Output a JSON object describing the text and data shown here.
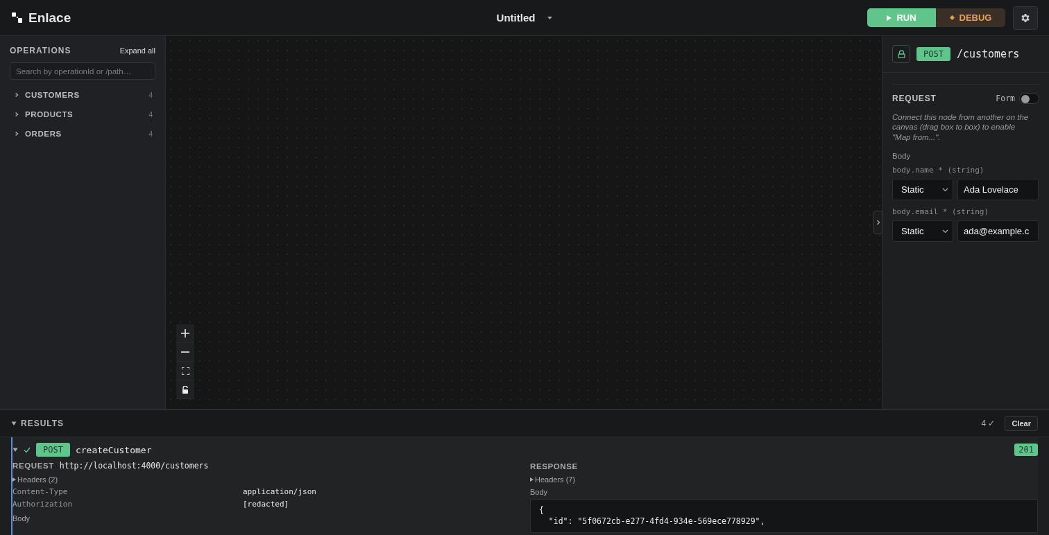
{
  "app": {
    "name": "Enlace"
  },
  "document": {
    "title": "Untitled"
  },
  "toolbar": {
    "run": "RUN",
    "debug": "DEBUG"
  },
  "sidebar": {
    "title": "OPERATIONS",
    "expand_all": "Expand all",
    "search": {
      "placeholder": "Search by operationId or /path…"
    },
    "groups": [
      {
        "label": "CUSTOMERS",
        "count": "4",
        "expanded": false
      },
      {
        "label": "PRODUCTS",
        "count": "4",
        "expanded": false
      },
      {
        "label": "ORDERS",
        "count": "4",
        "expanded": false
      }
    ]
  },
  "inspector": {
    "method": "POST",
    "path": "/customers",
    "section": "REQUEST",
    "form_toggle": {
      "label": "Form",
      "on": false
    },
    "hint": "Connect this node from another on the canvas (drag box to box) to enable \"Map from...\".",
    "body_label": "Body",
    "fields": [
      {
        "label": "body.name * (string)",
        "source": "Static",
        "value": "Ada Lovelace"
      },
      {
        "label": "body.email * (string)",
        "source": "Static",
        "value": "ada@example.c"
      }
    ]
  },
  "results": {
    "title": "RESULTS",
    "expanded": true,
    "count": "4 ✓",
    "clear": "Clear",
    "entries": [
      {
        "expanded": true,
        "ok": true,
        "method": "POST",
        "operation": "createCustomer",
        "status": "201",
        "request": {
          "label": "REQUEST",
          "url": "http://localhost:4000/customers",
          "headers_toggle": "Headers (2)",
          "headers": [
            {
              "name": "Content-Type",
              "value": "application/json"
            },
            {
              "name": "Authorization",
              "value": "[redacted]"
            }
          ],
          "body_label": "Body"
        },
        "response": {
          "label": "RESPONSE",
          "headers_toggle": "Headers (7)",
          "body_label": "Body",
          "body_lines": [
            "{",
            "  \"id\": \"5f0672cb-e277-4fd4-934e-569ece778929\","
          ]
        }
      }
    ]
  }
}
